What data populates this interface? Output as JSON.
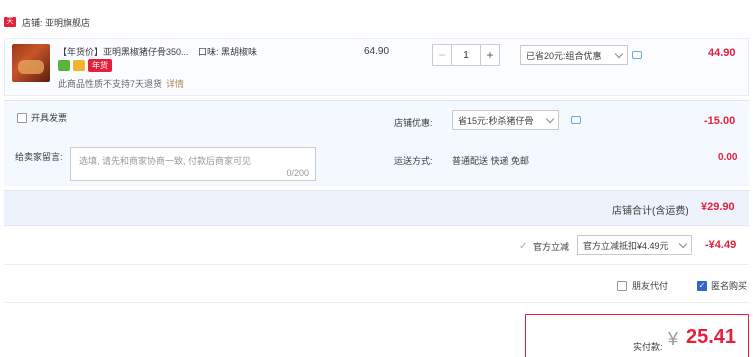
{
  "shop": {
    "badge": "天猫",
    "label": "店铺: 亚明旗舰店"
  },
  "item": {
    "title": "【年货价】亚明黑椒猪仔骨350...",
    "flavor": "口味: 黑胡椒味",
    "badge_new": "年货",
    "return_note": "此商品性质不支持7天退货",
    "detail_link": "详情",
    "unit_price": "64.90",
    "quantity": "1",
    "minus": "−",
    "plus": "+",
    "promo_select": "已省20元:组合优惠",
    "total": "44.90"
  },
  "invoice": {
    "label": "开具发票"
  },
  "store_discount": {
    "label": "店铺优惠:",
    "select": "省15元:秒杀猪仔骨",
    "amount": "-15.00"
  },
  "message": {
    "label": "给卖家留言:",
    "placeholder": "选填, 请先和商家协商一致, 付款后商家可见",
    "counter": "0/200"
  },
  "shipping": {
    "label": "运送方式:",
    "method": "普通配送 快递 免邮",
    "amount": "0.00"
  },
  "subtotal": {
    "label": "店铺合计(含运费)",
    "amount": "¥29.90"
  },
  "official_discount": {
    "label": "官方立减",
    "select": "官方立减抵扣¥4.49元",
    "amount": "-¥4.49"
  },
  "options": {
    "friend_pay": "朋友代付",
    "anonymous": "匿名购买"
  },
  "payment": {
    "label": "实付款:",
    "currency": "¥",
    "amount": "25.41"
  },
  "colors": {
    "accent_red": "#e4203b",
    "panel_blue": "#f4f8ff",
    "checkbox_blue": "#3366cc"
  }
}
